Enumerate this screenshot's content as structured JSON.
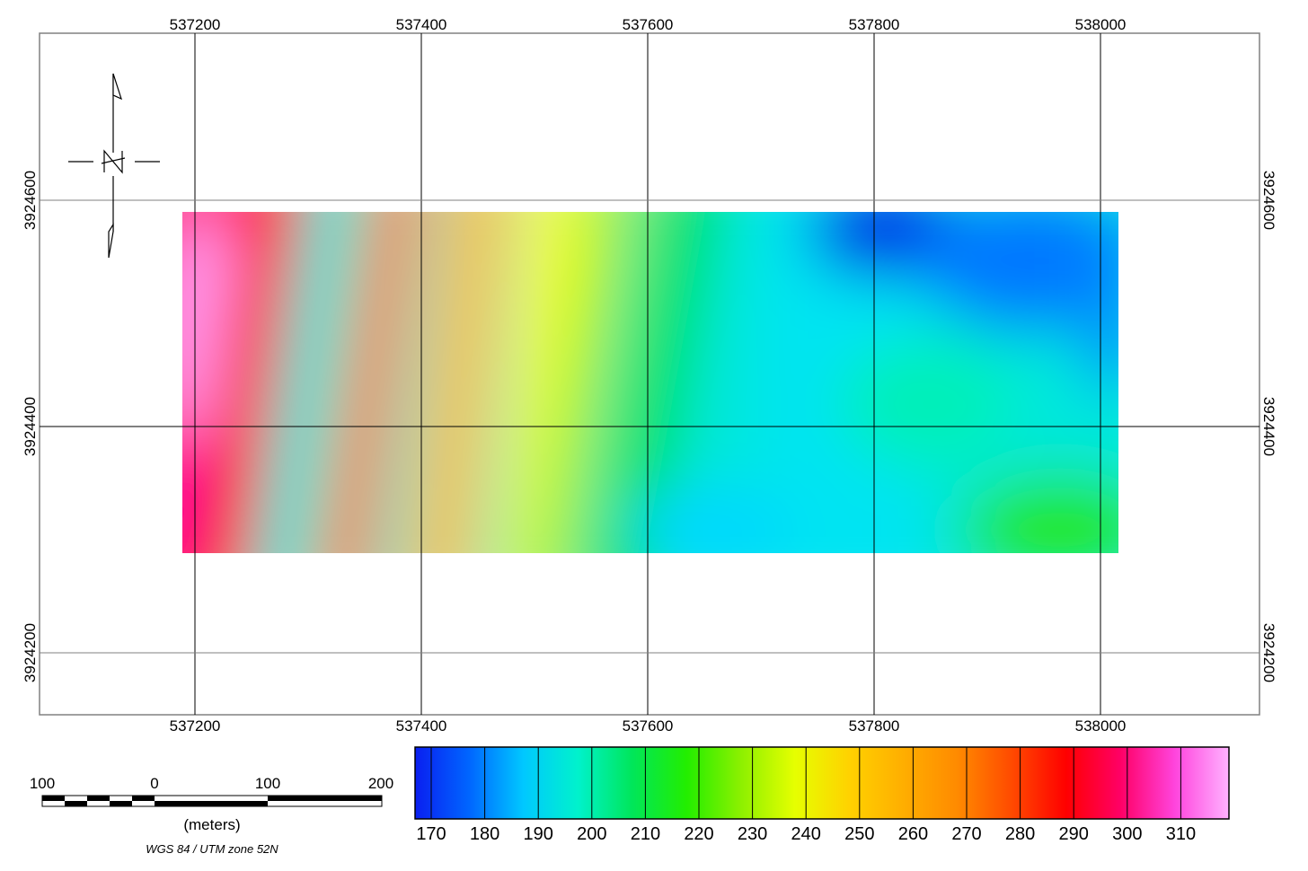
{
  "map": {
    "x_ticks": [
      "537200",
      "537400",
      "537600",
      "537800",
      "538000"
    ],
    "y_ticks": [
      "3924600",
      "3924400",
      "3924200"
    ],
    "north_label": "N"
  },
  "scale_bar": {
    "labels": [
      "100",
      "0",
      "100",
      "200"
    ],
    "units": "(meters)",
    "crs": "WGS 84 / UTM zone 52N"
  },
  "legend": {
    "labels": [
      "170",
      "180",
      "190",
      "200",
      "210",
      "220",
      "230",
      "240",
      "250",
      "260",
      "270",
      "280",
      "290",
      "300",
      "310"
    ],
    "colors": [
      "#0a1ff0",
      "#0066ff",
      "#00c8ff",
      "#00f2cc",
      "#00e65a",
      "#22ee00",
      "#8cf000",
      "#e6ff00",
      "#ffd200",
      "#ffae00",
      "#ff8a00",
      "#ff4a00",
      "#ff0000",
      "#ff0066",
      "#ff44dd",
      "#ffb2ff"
    ]
  },
  "colors": {
    "frame": "#808080",
    "grid": "#000000"
  }
}
